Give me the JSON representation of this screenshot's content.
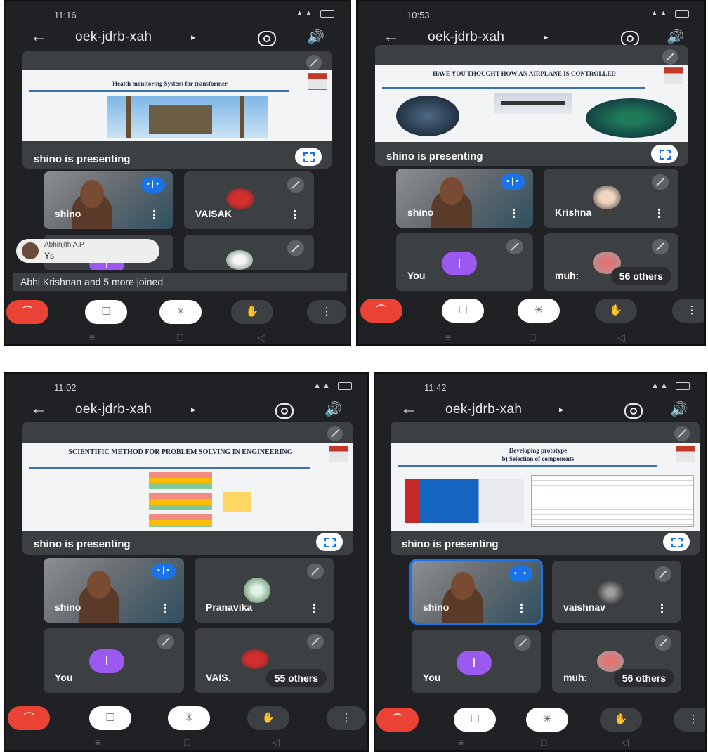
{
  "meeting_code": "oek-jdrb-xah",
  "presenting_label": "shino is presenting",
  "controls": {
    "end": "⌒",
    "camera": "☐",
    "mic": "✳",
    "hand": "✋",
    "more": "⋮"
  },
  "icons": [
    "back-arrow-icon",
    "camera-flip-icon",
    "speaker-icon",
    "mic-off-icon",
    "fullscreen-icon",
    "more-vert-icon",
    "speaking-indicator-icon",
    "end-call-icon",
    "camera-off-icon",
    "raise-hand-icon"
  ],
  "colors": {
    "background": "#202124",
    "tile": "#3c4043",
    "end_call": "#ea4335",
    "accent": "#1a73e8",
    "you_avatar": "#9b59f2"
  },
  "screens": [
    {
      "time": "11:16",
      "slide_title": "Health monitoring System for transformer",
      "tiles": [
        {
          "name": "shino",
          "type": "video",
          "speaking": true
        },
        {
          "name": "VAISAK",
          "type": "avatar",
          "muted": true
        }
      ],
      "toast": {
        "name": "Abhinjith A.P",
        "message": "Ys"
      },
      "join_message": "Abhi Krishnan and 5 more joined",
      "you_initial": "I"
    },
    {
      "time": "10:53",
      "slide_title": "HAVE YOU THOUGHT HOW AN AIRPLANE IS CONTROLLED",
      "tiles": [
        {
          "name": "shino",
          "type": "video",
          "speaking": true
        },
        {
          "name": "Krishna",
          "type": "avatar",
          "muted": true
        },
        {
          "name": "You",
          "type": "initial",
          "initial": "I",
          "muted": true
        },
        {
          "name": "muh:",
          "type": "avatar",
          "muted": true,
          "others": "56 others"
        }
      ]
    },
    {
      "time": "11:02",
      "slide_title": "SCIENTIFIC METHOD FOR PROBLEM SOLVING IN ENGINEERING",
      "tiles": [
        {
          "name": "shino",
          "type": "video",
          "speaking": true
        },
        {
          "name": "Pranavika",
          "type": "avatar",
          "muted": true
        },
        {
          "name": "You",
          "type": "initial",
          "initial": "I",
          "muted": true
        },
        {
          "name": "VAIS.",
          "type": "avatar",
          "muted": true,
          "others": "55 others"
        }
      ]
    },
    {
      "time": "11:42",
      "slide_title": "Developing prototype",
      "slide_subtitle": "b) Selection of components",
      "tiles": [
        {
          "name": "shino",
          "type": "video",
          "speaking": true,
          "active": true
        },
        {
          "name": "vaishnav",
          "type": "avatar",
          "muted": true
        },
        {
          "name": "You",
          "type": "initial",
          "initial": "I",
          "muted": true
        },
        {
          "name": "muh:",
          "type": "avatar",
          "muted": true,
          "others": "56 others"
        }
      ]
    }
  ]
}
